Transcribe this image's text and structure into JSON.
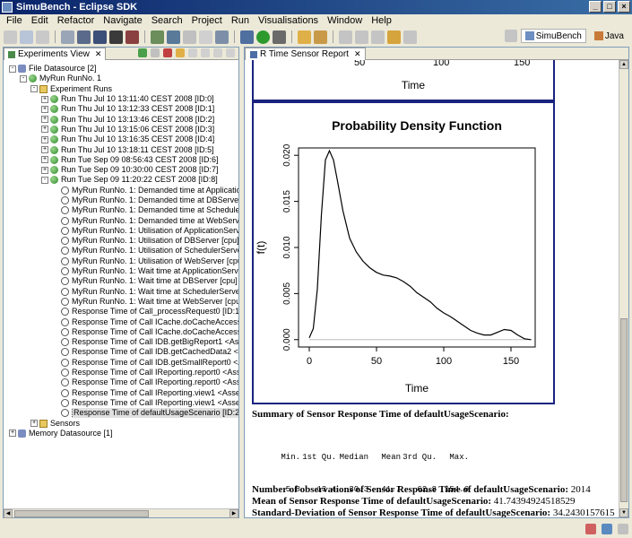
{
  "window": {
    "title": "SimuBench - Eclipse SDK"
  },
  "menu": [
    "File",
    "Edit",
    "Refactor",
    "Navigate",
    "Search",
    "Project",
    "Run",
    "Visualisations",
    "Window",
    "Help"
  ],
  "perspectives": {
    "simubench": "SimuBench",
    "java": "Java"
  },
  "left_view": {
    "tab_label": "Experiments View",
    "tree": [
      {
        "level": 0,
        "twisty": "-",
        "icon": "db",
        "label": "File Datasource [2]"
      },
      {
        "level": 1,
        "twisty": "-",
        "icon": "run",
        "label": "MyRun RunNo. 1"
      },
      {
        "level": 2,
        "twisty": "-",
        "icon": "folder",
        "label": "Experiment Runs"
      },
      {
        "level": 3,
        "twisty": "+",
        "icon": "run",
        "label": "Run Thu Jul 10 13:11:40 CEST 2008 [ID:0]"
      },
      {
        "level": 3,
        "twisty": "+",
        "icon": "run",
        "label": "Run Thu Jul 10 13:12:33 CEST 2008 [ID:1]"
      },
      {
        "level": 3,
        "twisty": "+",
        "icon": "run",
        "label": "Run Thu Jul 10 13:13:46 CEST 2008 [ID:2]"
      },
      {
        "level": 3,
        "twisty": "+",
        "icon": "run",
        "label": "Run Thu Jul 10 13:15:06 CEST 2008 [ID:3]"
      },
      {
        "level": 3,
        "twisty": "+",
        "icon": "run",
        "label": "Run Thu Jul 10 13:16:35 CEST 2008 [ID:4]"
      },
      {
        "level": 3,
        "twisty": "+",
        "icon": "run",
        "label": "Run Thu Jul 10 13:18:11 CEST 2008 [ID:5]"
      },
      {
        "level": 3,
        "twisty": "+",
        "icon": "run",
        "label": "Run Tue Sep 09 08:56:43 CEST 2008 [ID:6]"
      },
      {
        "level": 3,
        "twisty": "+",
        "icon": "run",
        "label": "Run Tue Sep 09 10:30:00 CEST 2008 [ID:7]"
      },
      {
        "level": 3,
        "twisty": "-",
        "icon": "run",
        "label": "Run Tue Sep 09 11:20:22 CEST 2008 [ID:8]"
      },
      {
        "level": 4,
        "twisty": "",
        "icon": "sensor",
        "label": "MyRun RunNo. 1: Demanded time at ApplicationServer ["
      },
      {
        "level": 4,
        "twisty": "",
        "icon": "sensor",
        "label": "MyRun RunNo. 1: Demanded time at DBServer [cpu] <_"
      },
      {
        "level": 4,
        "twisty": "",
        "icon": "sensor",
        "label": "MyRun RunNo. 1: Demanded time at SchedulerServer [c"
      },
      {
        "level": 4,
        "twisty": "",
        "icon": "sensor",
        "label": "MyRun RunNo. 1: Demanded time at WebServer [cpu] <_"
      },
      {
        "level": 4,
        "twisty": "",
        "icon": "sensor",
        "label": "MyRun RunNo. 1: Utilisation of ApplicationServer [cpu]"
      },
      {
        "level": 4,
        "twisty": "",
        "icon": "sensor",
        "label": "MyRun RunNo. 1: Utilisation of DBServer [cpu] <_U2Nv"
      },
      {
        "level": 4,
        "twisty": "",
        "icon": "sensor",
        "label": "MyRun RunNo. 1: Utilisation of SchedulerServer [cpu] <"
      },
      {
        "level": 4,
        "twisty": "",
        "icon": "sensor",
        "label": "MyRun RunNo. 1: Utilisation of WebServer [cpu] <_8-cp"
      },
      {
        "level": 4,
        "twisty": "",
        "icon": "sensor",
        "label": "MyRun RunNo. 1: Wait time at ApplicationServer [cpu]"
      },
      {
        "level": 4,
        "twisty": "",
        "icon": "sensor",
        "label": "MyRun RunNo. 1: Wait time at DBServer [cpu] <_U2Nv"
      },
      {
        "level": 4,
        "twisty": "",
        "icon": "sensor",
        "label": "MyRun RunNo. 1: Wait time at SchedulerServer [cpu] <"
      },
      {
        "level": 4,
        "twisty": "",
        "icon": "sensor",
        "label": "MyRun RunNo. 1: Wait time at WebServer [cpu] <_8-cp"
      },
      {
        "level": 4,
        "twisty": "",
        "icon": "sensor",
        "label": "Response Time of Call_processRequest0 [ID:16]"
      },
      {
        "level": 4,
        "twisty": "",
        "icon": "sensor",
        "label": "Response Time of Call ICache.doCacheAccess0 <Assem"
      },
      {
        "level": 4,
        "twisty": "",
        "icon": "sensor",
        "label": "Response Time of Call ICache.doCacheAccess0 <Assem"
      },
      {
        "level": 4,
        "twisty": "",
        "icon": "sensor",
        "label": "Response Time of Call IDB.getBigReport1 <AssemblyCt"
      },
      {
        "level": 4,
        "twisty": "",
        "icon": "sensor",
        "label": "Response Time of Call IDB.getCachedData2 <AssemblyC"
      },
      {
        "level": 4,
        "twisty": "",
        "icon": "sensor",
        "label": "Response Time of Call IDB.getSmallReport0 <AssemblyC"
      },
      {
        "level": 4,
        "twisty": "",
        "icon": "sensor",
        "label": "Response Time of Call IReporting.report0 <AssemblyCt"
      },
      {
        "level": 4,
        "twisty": "",
        "icon": "sensor",
        "label": "Response Time of Call IReporting.report0 <AssemblyCt"
      },
      {
        "level": 4,
        "twisty": "",
        "icon": "sensor",
        "label": "Response Time of Call IReporting.view1 <AssemblyCtx:"
      },
      {
        "level": 4,
        "twisty": "",
        "icon": "sensor",
        "label": "Response Time of Call IReporting.view1 <AssemblyCtx:"
      },
      {
        "level": 4,
        "twisty": "",
        "icon": "sensor",
        "label": "Response Time of defaultUsageScenario [ID:20]",
        "selected": true
      },
      {
        "level": 2,
        "twisty": "+",
        "icon": "folder",
        "label": "Sensors"
      },
      {
        "level": 0,
        "twisty": "+",
        "icon": "db",
        "label": "Memory Datasource [1]"
      }
    ]
  },
  "editor": {
    "tab_label": "R Time Sensor Report",
    "top_chart": {
      "xlabel": "Time",
      "ticks": [
        "50",
        "100",
        "150"
      ]
    },
    "chart_data": {
      "type": "line",
      "title": "Probability Density Function",
      "xlabel": "Time",
      "ylabel": "f(t)",
      "xlim": [
        -8,
        168
      ],
      "ylim": [
        -0.0008,
        0.0208
      ],
      "xticks": [
        0,
        50,
        100,
        150
      ],
      "yticks": [
        0.0,
        0.005,
        0.01,
        0.015,
        0.02
      ],
      "ytick_labels": [
        "0.000",
        "0.005",
        "0.010",
        "0.015",
        "0.020"
      ],
      "xtick_labels": [
        "0",
        "50",
        "100",
        "150"
      ],
      "grid": false,
      "x": [
        0,
        3,
        6,
        9,
        12,
        15,
        18,
        21,
        25,
        30,
        35,
        40,
        45,
        50,
        55,
        60,
        65,
        70,
        75,
        80,
        85,
        90,
        95,
        100,
        105,
        110,
        115,
        120,
        125,
        130,
        135,
        140,
        145,
        150,
        155,
        160,
        165
      ],
      "y": [
        0.0002,
        0.0012,
        0.0055,
        0.0135,
        0.0195,
        0.0205,
        0.0195,
        0.0172,
        0.014,
        0.011,
        0.0095,
        0.0085,
        0.0078,
        0.0073,
        0.007,
        0.0069,
        0.0067,
        0.0063,
        0.0058,
        0.0051,
        0.0046,
        0.0041,
        0.0034,
        0.0029,
        0.0025,
        0.002,
        0.0015,
        0.001,
        0.0007,
        0.0005,
        0.0005,
        0.0008,
        0.0011,
        0.001,
        0.0005,
        0.0001,
        0.0
      ]
    },
    "summary_title": "Summary of Sensor Response Time of defaultUsageScenario:",
    "stats": {
      "headers": [
        "Min.",
        "1st Qu.",
        "Median",
        "Mean",
        "3rd Qu.",
        "Max."
      ],
      "values": [
        "5.8",
        "13.4",
        "30.3",
        "41.7",
        "62.8",
        "154.6"
      ]
    },
    "metrics": [
      {
        "label": "Number of observations of Sensor Response Time of defaultUsageScenario:",
        "value": "2014"
      },
      {
        "label": "Mean of Sensor Response Time of defaultUsageScenario:",
        "value": "41.74394924518529"
      },
      {
        "label": "Standard-Deviation of Sensor Response Time of defaultUsageScenario:",
        "value": "34.2430157615"
      }
    ]
  }
}
